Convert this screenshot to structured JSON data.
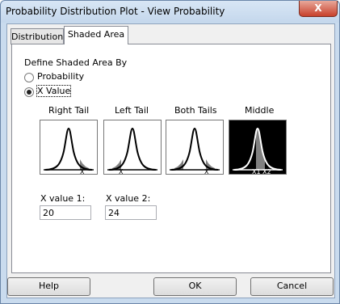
{
  "window": {
    "title": "Probability Distribution Plot - View Probability",
    "close_glyph": "X"
  },
  "tabs": [
    {
      "label": "Distribution"
    },
    {
      "label": "Shaded Area"
    }
  ],
  "shaded": {
    "group_label": "Define Shaded Area By",
    "options": [
      {
        "label": "Probability",
        "checked": false
      },
      {
        "label": "X Value",
        "checked": true
      }
    ],
    "types": [
      {
        "label": "Right Tail",
        "marker": "X"
      },
      {
        "label": "Left Tail",
        "marker": "X"
      },
      {
        "label": "Both Tails",
        "marker": "X"
      },
      {
        "label": "Middle",
        "marker_a": "X1",
        "marker_b": "X2"
      }
    ],
    "x1": {
      "label": "X value 1:",
      "value": "20"
    },
    "x2": {
      "label": "X value 2:",
      "value": "24"
    }
  },
  "buttons": {
    "help": "Help",
    "ok": "OK",
    "cancel": "Cancel"
  }
}
